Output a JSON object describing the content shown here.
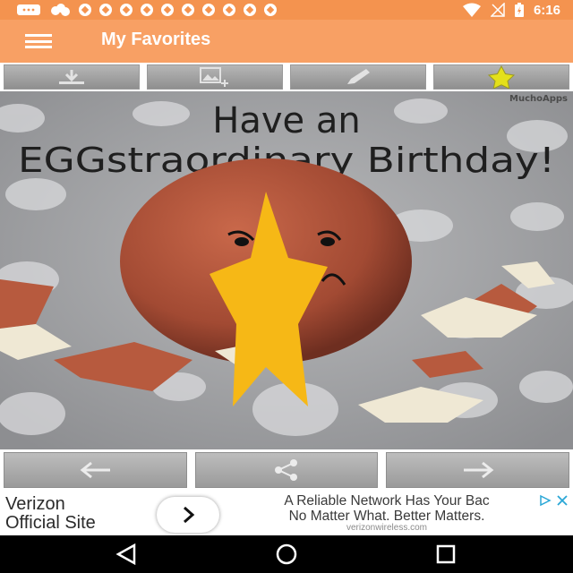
{
  "status_bar": {
    "time": "6:16",
    "notification_icons": [
      "app-icon-1",
      "app-icon-2",
      "soccer-icon",
      "soccer-icon",
      "soccer-icon",
      "soccer-icon",
      "soccer-icon",
      "soccer-icon",
      "soccer-icon",
      "soccer-icon",
      "soccer-icon",
      "soccer-icon"
    ],
    "right_icons": [
      "wifi-icon",
      "no-signal-icon",
      "battery-icon"
    ]
  },
  "app_bar": {
    "title": "My Favorites",
    "menu_icon": "hamburger-icon"
  },
  "toolbar": {
    "buttons": [
      "download-icon",
      "add-image-icon",
      "edit-pencil-icon",
      "favorite-star-icon"
    ],
    "accent_star_color": "#e4e01a"
  },
  "card": {
    "watermark": "MuchoApps",
    "headline_line1": "Have an",
    "headline_line2": "EGGstraordinary Birthday!",
    "overlay_star_color": "#f6b816"
  },
  "bottom_nav": {
    "buttons": [
      "arrow-left-icon",
      "share-icon",
      "arrow-right-icon"
    ]
  },
  "ad": {
    "brand_line1": "Verizon",
    "brand_line2": "Official Site",
    "text_line1": "A Reliable Network Has Your Bac",
    "text_line2": "No Matter What. Better Matters.",
    "url": "verizonwireless.com",
    "go_icon": "chevron-right-icon"
  },
  "system_nav": [
    "back-triangle-icon",
    "home-circle-icon",
    "recents-square-icon"
  ]
}
